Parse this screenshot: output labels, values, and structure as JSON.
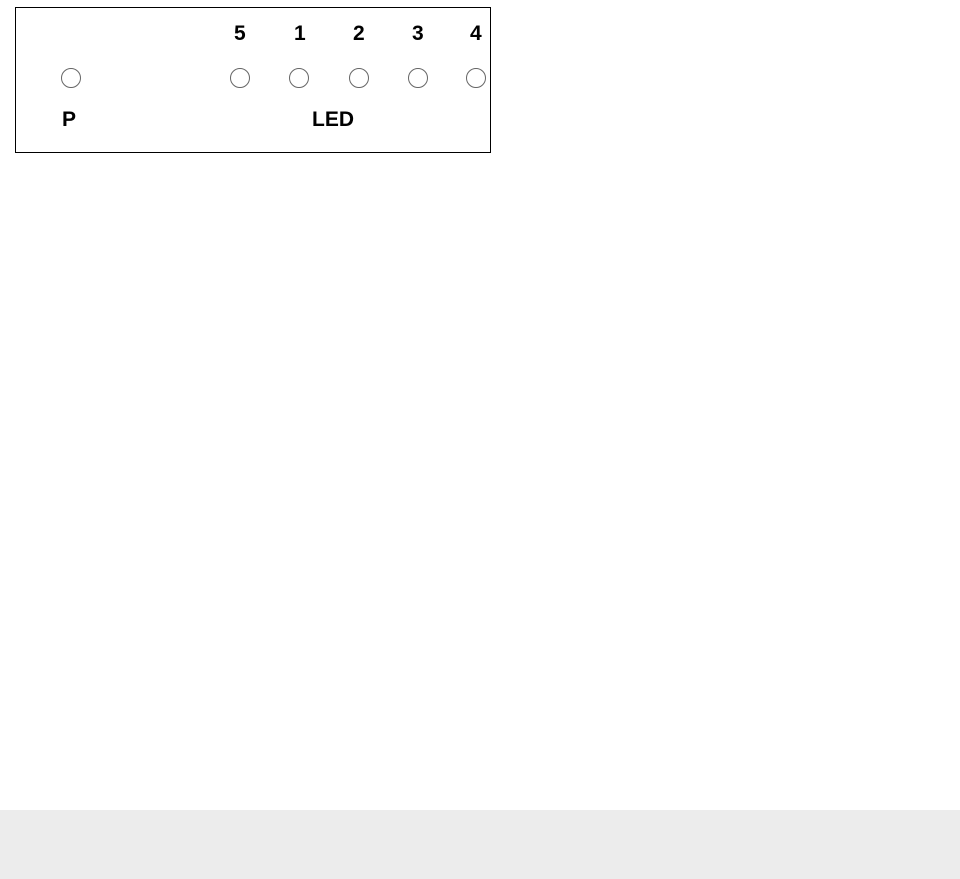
{
  "panel": {
    "p_label": "P",
    "led_label": "LED",
    "led_numbers": [
      "5",
      "1",
      "2",
      "3",
      "4"
    ]
  }
}
